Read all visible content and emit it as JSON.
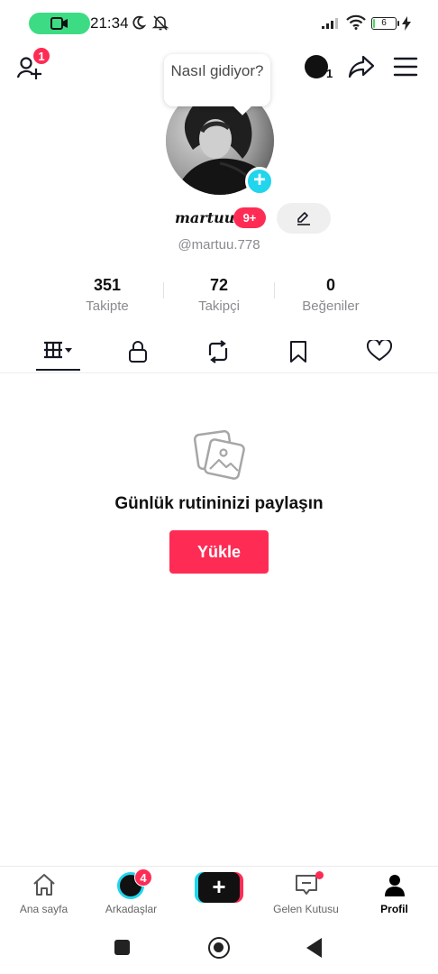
{
  "status_bar": {
    "time": "21:34",
    "battery": "6",
    "icons": [
      "video-record-icon",
      "moon-icon",
      "bell-off-icon",
      "signal-icon",
      "wifi-icon",
      "battery-icon",
      "charging-icon"
    ]
  },
  "top_nav": {
    "add_friend_badge": "1",
    "account_count": "1",
    "icons": [
      "add-friend-icon",
      "account-switch-icon",
      "share-icon",
      "menu-icon"
    ]
  },
  "profile": {
    "bubble_text": "Nasıl gidiyor?",
    "display_name": "martuu",
    "level_badge": "9+",
    "username": "@martuu.778"
  },
  "stats": [
    {
      "value": "351",
      "label": "Takipte"
    },
    {
      "value": "72",
      "label": "Takipçi"
    },
    {
      "value": "0",
      "label": "Beğeniler"
    }
  ],
  "tabs": [
    "videos-grid-icon",
    "lock-icon",
    "repost-icon",
    "bookmark-icon",
    "heart-icon"
  ],
  "empty_state": {
    "title": "Günlük rutininizi paylaşın",
    "button": "Yükle"
  },
  "bottom_nav": {
    "home": "Ana sayfa",
    "friends": "Arkadaşlar",
    "friends_badge": "4",
    "create": "+",
    "inbox": "Gelen Kutusu",
    "profile": "Profil"
  },
  "colors": {
    "accent": "#fe2c55",
    "cyan": "#20d5ec",
    "text": "#161823",
    "secondary": "#8a8b91"
  }
}
